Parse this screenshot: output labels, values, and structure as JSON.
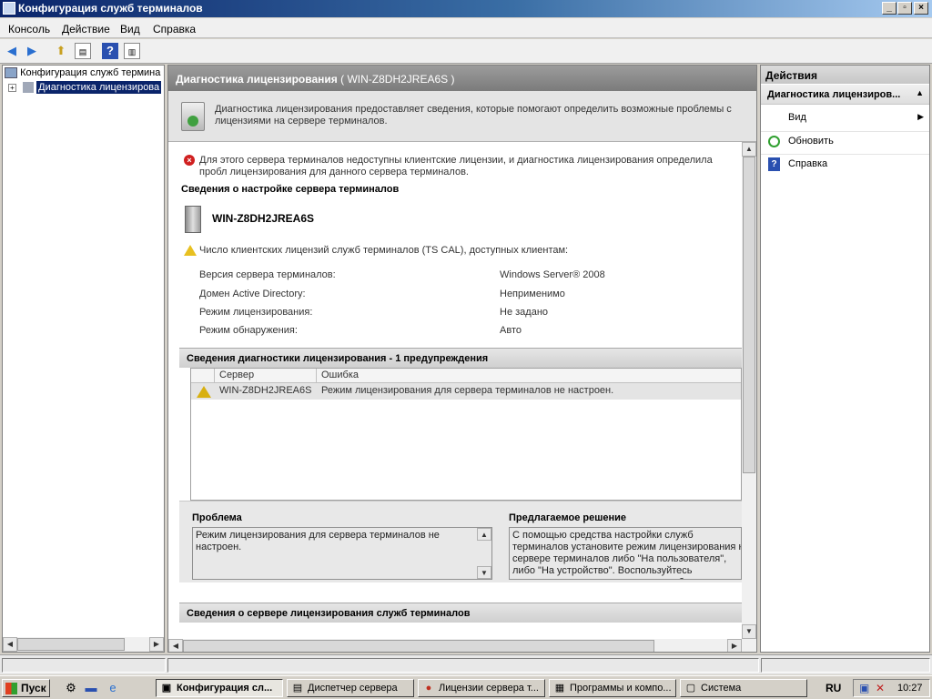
{
  "window": {
    "title": "Конфигурация служб терминалов"
  },
  "menu": [
    "Консоль",
    "Действие",
    "Вид",
    "Справка"
  ],
  "tree": {
    "root": "Конфигурация служб термина",
    "child": "Диагностика лицензирова"
  },
  "center": {
    "header_title": "Диагностика лицензирования",
    "header_server": "( WIN-Z8DH2JREA6S )",
    "description": "Диагностика лицензирования предоставляет сведения, которые помогают определить возможные проблемы с лицензиями на сервере терминалов.",
    "error_text": "Для этого сервера терминалов недоступны клиентские лицензии, и диагностика лицензирования определила пробл лицензирования для данного сервера терминалов.",
    "config_title": "Сведения о настройке сервера терминалов",
    "server_name": "WIN-Z8DH2JREA6S",
    "cal_warning": "Число клиентских лицензий служб терминалов (TS CAL), доступных клиентам:",
    "props": [
      {
        "label": "Версия сервера терминалов:",
        "value": "Windows Server® 2008"
      },
      {
        "label": "Домен Active Directory:",
        "value": "Неприменимо"
      },
      {
        "label": "Режим лицензирования:",
        "value": "Не задано"
      },
      {
        "label": "Режим обнаружения:",
        "value": "Авто"
      }
    ],
    "diag_section": "Сведения диагностики лицензирования - 1 предупреждения",
    "grid": {
      "columns": [
        "Сервер",
        "Ошибка"
      ],
      "rows": [
        {
          "server": "WIN-Z8DH2JREA6S",
          "error": "Режим лицензирования для сервера терминалов не настроен."
        }
      ]
    },
    "problem_label": "Проблема",
    "problem_text": "Режим лицензирования для сервера терминалов не настроен.",
    "solution_label": "Предлагаемое решение",
    "solution_text": "С помощью средства настройки служб терминалов установите режим лицензирования на сервере терминалов либо \"На пользователя\", либо \"На устройство\". Воспользуйтесь диспетчером лицензирования служб",
    "licserver_section": "Сведения о сервере лицензирования служб терминалов"
  },
  "actions": {
    "header": "Действия",
    "subheader": "Диагностика лицензиров...",
    "items": [
      "Вид",
      "Обновить",
      "Справка"
    ]
  },
  "taskbar": {
    "start": "Пуск",
    "tasks": [
      "Конфигурация сл...",
      "Диспетчер сервера",
      "Лицензии сервера т...",
      "Программы и компо...",
      "Система"
    ],
    "lang": "RU",
    "clock": "10:27"
  }
}
